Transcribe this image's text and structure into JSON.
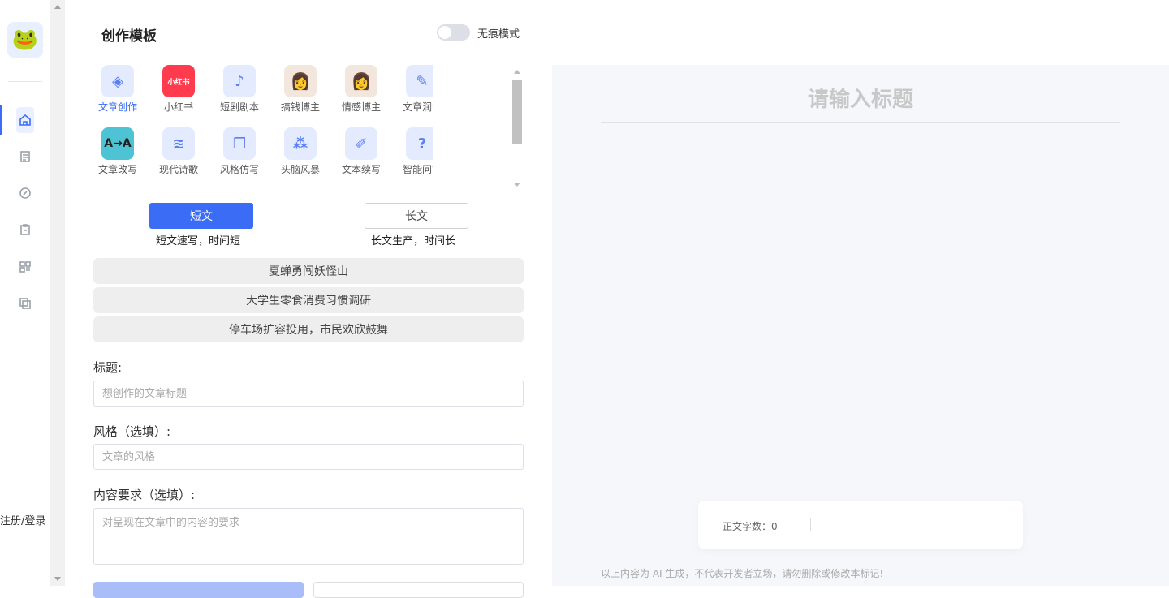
{
  "sidebar": {
    "logo": "🐸",
    "nav": [
      "home-icon",
      "document-icon",
      "link-icon",
      "clipboard-icon",
      "grid-icon",
      "copy-icon"
    ],
    "login": "注册/登录"
  },
  "panel": {
    "title": "创作模板",
    "toggle_label": "无痕模式",
    "templates": [
      {
        "label": "文章创作",
        "icon": "◈"
      },
      {
        "label": "小红书",
        "icon": "小红书"
      },
      {
        "label": "短剧剧本",
        "icon": "♪"
      },
      {
        "label": "搞钱博主",
        "icon": "👩"
      },
      {
        "label": "情感博主",
        "icon": "👩"
      },
      {
        "label": "文章润色",
        "icon": "✎"
      },
      {
        "label": "文章改写",
        "icon": "A→A"
      },
      {
        "label": "现代诗歌",
        "icon": "≋"
      },
      {
        "label": "风格仿写",
        "icon": "❐"
      },
      {
        "label": "头脑风暴",
        "icon": "⁂"
      },
      {
        "label": "文本续写",
        "icon": "✐"
      },
      {
        "label": "智能问答",
        "icon": "?"
      }
    ],
    "modes": {
      "short": {
        "label": "短文",
        "desc": "短文速写，时间短"
      },
      "long": {
        "label": "长文",
        "desc": "长文生产，时间长"
      }
    },
    "suggestions": [
      "夏蝉勇闯妖怪山",
      "大学生零食消费习惯调研",
      "停车场扩容投用，市民欢欣鼓舞"
    ],
    "fields": {
      "title_label": "标题:",
      "title_placeholder": "想创作的文章标题",
      "style_label": "风格（选填）:",
      "style_placeholder": "文章的风格",
      "content_label": "内容要求（选填）:",
      "content_placeholder": "对呈现在文章中的内容的要求"
    }
  },
  "preview": {
    "title": "请输入标题",
    "count_label": "正文字数：0",
    "disclaimer": "以上内容为 AI 生成，不代表开发者立场，请勿删除或修改本标记!"
  },
  "colors": {
    "accent": "#3b6cf6",
    "preview_bg": "#f6f7fb"
  }
}
